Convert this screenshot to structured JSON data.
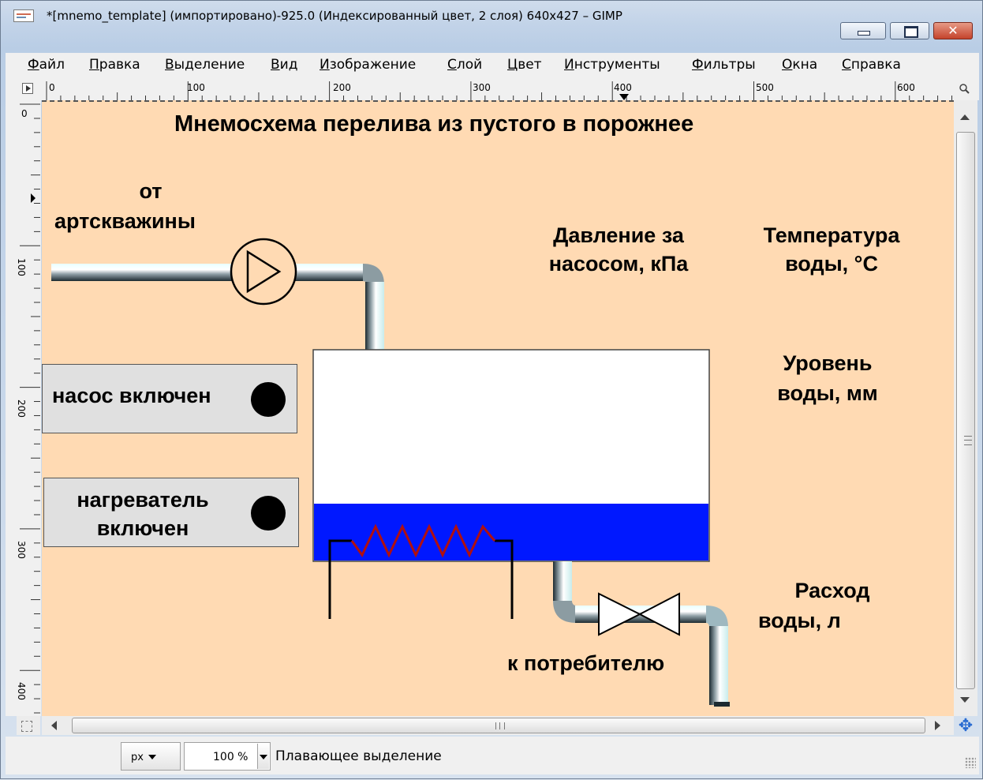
{
  "window": {
    "title": "*[mnemo_template] (импортировано)-925.0 (Индексированный цвет, 2 слоя) 640x427 – GIMP",
    "close_glyph": "✕"
  },
  "menu": [
    "Файл",
    "Правка",
    "Выделение",
    "Вид",
    "Изображение",
    "Слой",
    "Цвет",
    "Инструменты",
    "Фильтры",
    "Окна",
    "Справка"
  ],
  "ruler": {
    "top_labels": [
      "0",
      "100",
      "200",
      "300",
      "400",
      "500",
      "600"
    ],
    "left_labels": [
      "0",
      "100",
      "200",
      "300",
      "400"
    ]
  },
  "scheme": {
    "title": "Мнемосхема перелива из пустого в порожнее",
    "source_line1": "от",
    "source_line2": "артскважины",
    "pressure_line1": "Давление за",
    "pressure_line2": "насосом, кПа",
    "temp_line1": "Температура",
    "temp_line2": "воды, °С",
    "level_line1": "Уровень",
    "level_line2": "воды, мм",
    "flow_line1": "Расход",
    "flow_line2": "воды, л",
    "consumer": "к потребителю",
    "pump_status": "насос включен",
    "heater_line1": "нагреватель",
    "heater_line2": "включен",
    "water_level_fraction": 0.27,
    "colors": {
      "background": "#ffdab3",
      "water": "#0018ff",
      "heater": "#b01010",
      "lamp": "#000000"
    }
  },
  "statusbar": {
    "unit": "px",
    "zoom": "100 %",
    "message": "Плавающее выделение"
  },
  "icons": [
    "app-icon",
    "minimize-icon",
    "maximize-icon",
    "close-icon",
    "ruler-toggle-icon",
    "zoom-fit-icon",
    "quick-mask-icon",
    "navigate-icon",
    "resize-grip-icon",
    "pump-icon",
    "valve-icon",
    "heater-icon",
    "indicator-lamp-icon"
  ]
}
